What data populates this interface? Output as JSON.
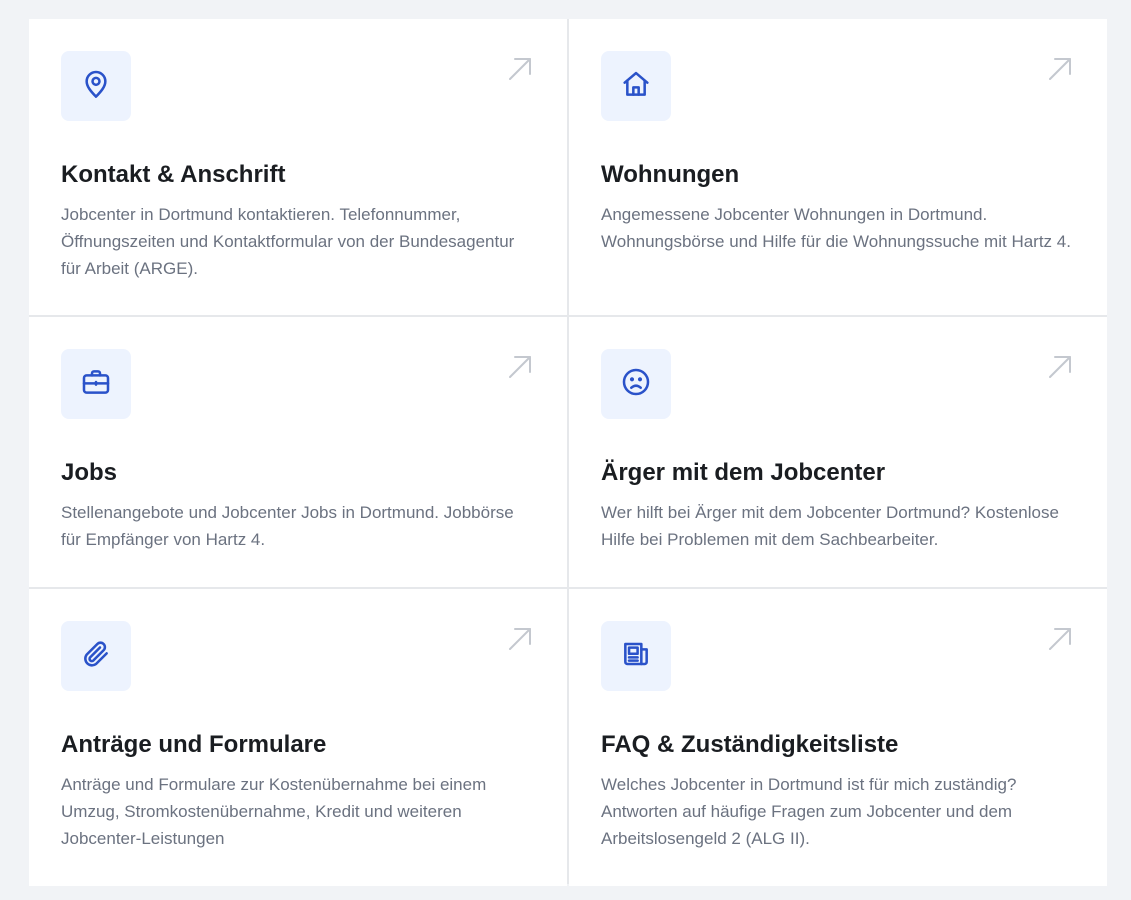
{
  "cards": [
    {
      "icon": "map-pin-icon",
      "title": "Kontakt & Anschrift",
      "description": "Jobcenter in Dortmund kontaktieren. Telefonnummer, Öffnungszeiten und Kontaktformular von der Bundesagentur für Arbeit (ARGE)."
    },
    {
      "icon": "home-icon",
      "title": "Wohnungen",
      "description": "Angemessene Jobcenter Wohnungen in Dortmund. Wohnungsbörse und Hilfe für die Wohnungssuche mit Hartz 4."
    },
    {
      "icon": "briefcase-icon",
      "title": "Jobs",
      "description": "Stellenangebote und Jobcenter Jobs in Dortmund. Jobbörse für Empfänger von Hartz 4."
    },
    {
      "icon": "sad-face-icon",
      "title": "Ärger mit dem Jobcenter",
      "description": "Wer hilft bei Ärger mit dem Jobcenter Dortmund? Kostenlose Hilfe bei Problemen mit dem Sachbearbeiter."
    },
    {
      "icon": "paperclip-icon",
      "title": "Anträge und Formulare",
      "description": "Anträge und Formulare zur Kostenübernahme bei einem Umzug, Stromkostenübernahme, Kredit und weiteren Jobcenter-Leistungen"
    },
    {
      "icon": "newspaper-icon",
      "title": "FAQ & Zuständigkeitsliste",
      "description": "Welches Jobcenter in Dortmund ist für mich zuständig? Antworten auf häufige Fragen zum Jobcenter und dem Arbeitslosengeld 2 (ALG II)."
    }
  ],
  "colors": {
    "accent": "#2a52c9",
    "icon_bg": "#edf3fe",
    "arrow": "#c4c8cf"
  }
}
